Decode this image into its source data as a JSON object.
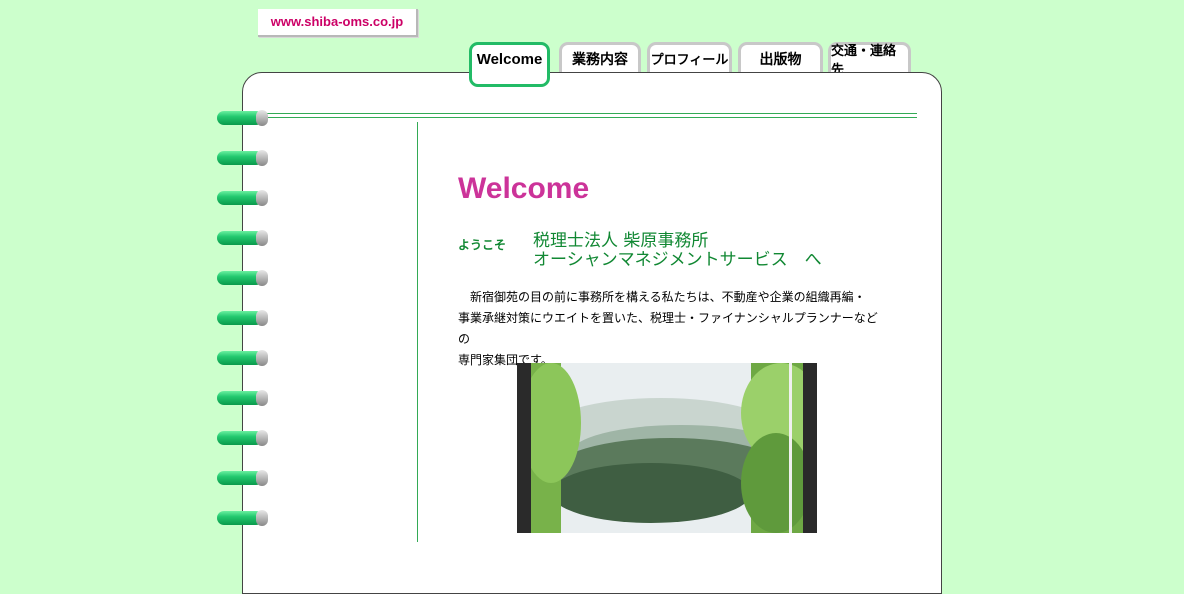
{
  "logo": {
    "text": "www.shiba-oms.co.jp"
  },
  "tabs": [
    {
      "label": "Welcome",
      "active": true
    },
    {
      "label": "業務内容",
      "active": false
    },
    {
      "label": "プロフィール",
      "active": false
    },
    {
      "label": "出版物",
      "active": false
    },
    {
      "label": "交通・連絡先",
      "active": false
    }
  ],
  "main": {
    "heading": "Welcome",
    "greeting": "ようこそ",
    "firm_line1": "税理士法人 柴原事務所",
    "firm_line2": "オーシャンマネジメントサービス　へ",
    "intro_line1": "　新宿御苑の目の前に事務所を構える私たちは、不動産や企業の組織再編・",
    "intro_line2": "事業承継対策にウエイトを置いた、税理士・ファイナンシャルプランナーなどの",
    "intro_line3": "専門家集団です。"
  },
  "colors": {
    "background": "#ccffcc",
    "accent_green": "#118833",
    "heading_pink": "#cc3399",
    "logo_text": "#cc0066"
  }
}
